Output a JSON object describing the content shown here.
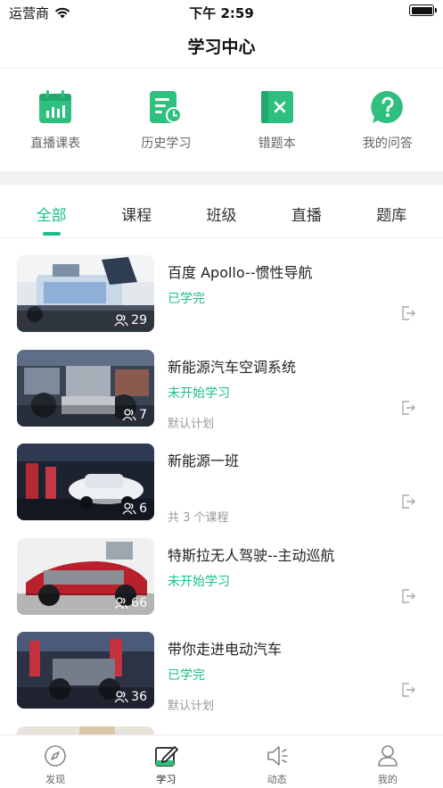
{
  "status_bar": {
    "carrier": "运营商",
    "time": "下午 2:59"
  },
  "nav": {
    "title": "学习中心"
  },
  "quick_access": [
    {
      "label": "直播课表",
      "icon": "calendar-chart-icon"
    },
    {
      "label": "历史学习",
      "icon": "history-clock-icon"
    },
    {
      "label": "错题本",
      "icon": "wrong-book-icon"
    },
    {
      "label": "我的问答",
      "icon": "question-bubble-icon"
    }
  ],
  "tabs": [
    "全部",
    "课程",
    "班级",
    "直播",
    "题库"
  ],
  "active_tab": 0,
  "courses": [
    {
      "title": "百度 Apollo--惯性导航",
      "status": "已学完",
      "subtitle": "",
      "count": "29"
    },
    {
      "title": "新能源汽车空调系统",
      "status": "未开始学习",
      "subtitle": "默认计划",
      "count": "7"
    },
    {
      "title": "新能源一班",
      "status": "",
      "subtitle": "共 3 个课程",
      "count": "6"
    },
    {
      "title": "特斯拉无人驾驶--主动巡航",
      "status": "未开始学习",
      "subtitle": "",
      "count": "66"
    },
    {
      "title": "带你走进电动汽车",
      "status": "已学完",
      "subtitle": "默认计划",
      "count": "36"
    }
  ],
  "tabbar": [
    {
      "label": "发现",
      "icon": "compass-icon"
    },
    {
      "label": "学习",
      "icon": "pencil-note-icon"
    },
    {
      "label": "动态",
      "icon": "speaker-icon"
    },
    {
      "label": "我的",
      "icon": "person-icon"
    }
  ],
  "colors": {
    "accent": "#1dbd8a",
    "icon_green": "#2fbf7f",
    "band": "#f2f2f2"
  }
}
